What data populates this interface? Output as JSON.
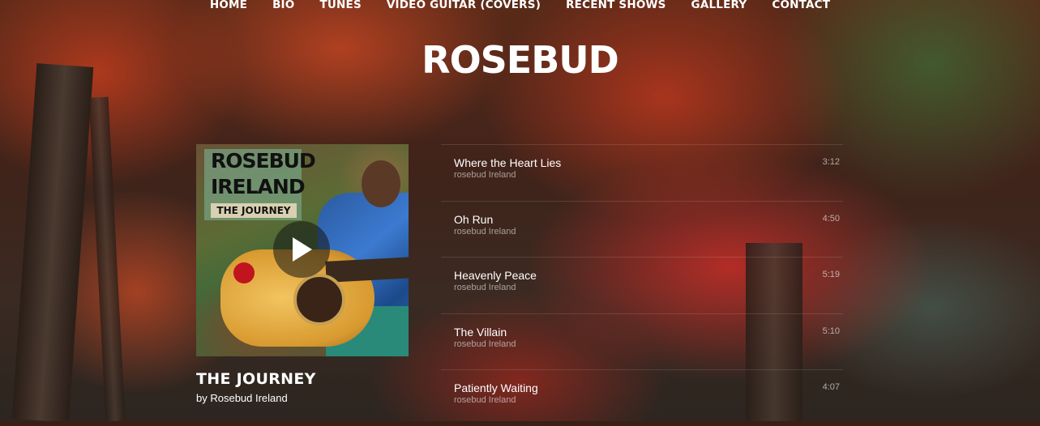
{
  "nav": {
    "items": [
      {
        "label": "HOME"
      },
      {
        "label": "BIO"
      },
      {
        "label": "TUNES"
      },
      {
        "label": "VIDEO GUITAR (COVERS)"
      },
      {
        "label": "RECENT SHOWS"
      },
      {
        "label": "GALLERY"
      },
      {
        "label": "CONTACT"
      }
    ]
  },
  "site_title": "ROSEBUD",
  "player": {
    "album_art": {
      "line1": "ROSEBUD",
      "line2": "IRELAND",
      "subtitle": "THE JOURNEY"
    },
    "play_icon": "play-icon",
    "album_title": "THE JOURNEY",
    "album_artist": "by Rosebud Ireland",
    "tracks": [
      {
        "title": "Where the Heart Lies",
        "artist": "rosebud Ireland",
        "duration": "3:12"
      },
      {
        "title": "Oh Run",
        "artist": "rosebud Ireland",
        "duration": "4:50"
      },
      {
        "title": "Heavenly Peace",
        "artist": "rosebud Ireland",
        "duration": "5:19"
      },
      {
        "title": "The Villain",
        "artist": "rosebud Ireland",
        "duration": "5:10"
      },
      {
        "title": "Patiently Waiting",
        "artist": "rosebud Ireland",
        "duration": "4:07"
      }
    ]
  }
}
